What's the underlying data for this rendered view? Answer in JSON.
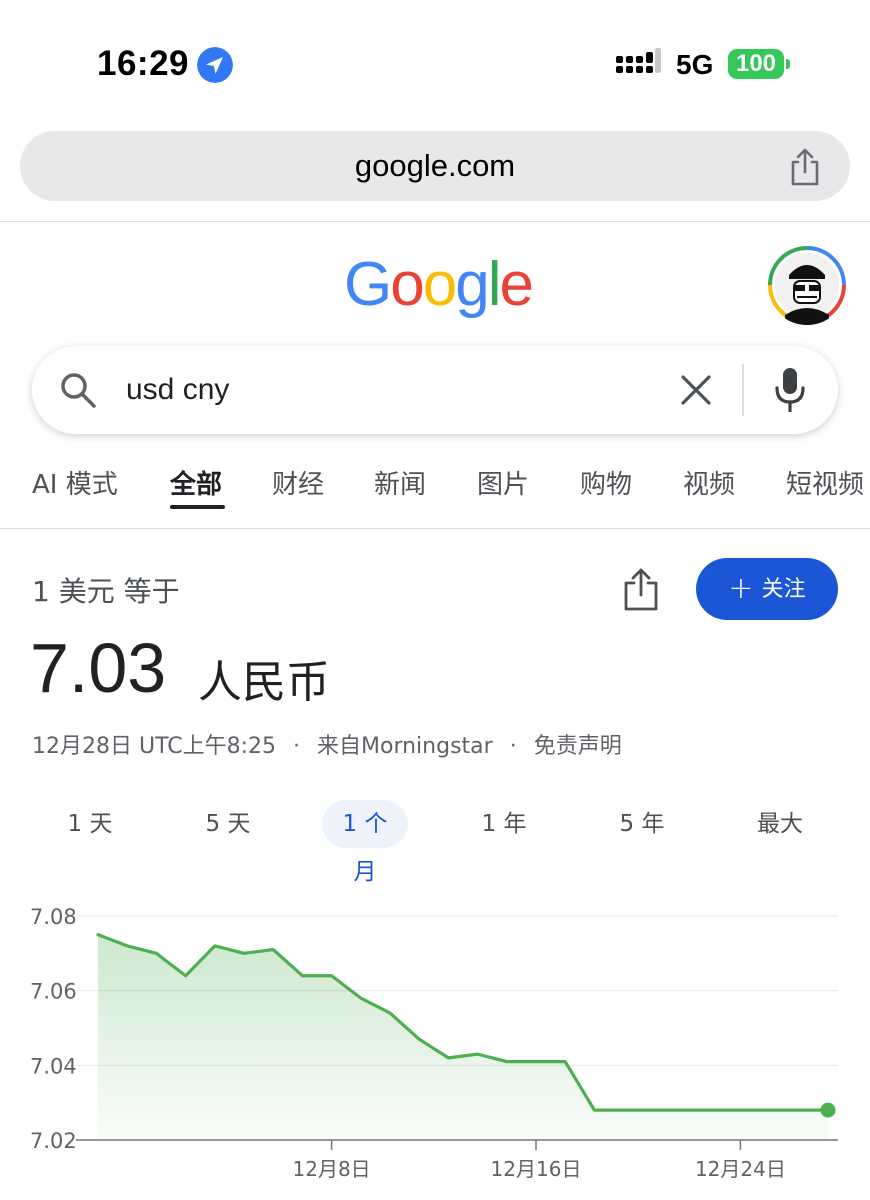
{
  "status_bar": {
    "time": "16:29",
    "location_icon": "location-arrow-icon",
    "signal_icon": "cellular-signal-icon",
    "network": "5G",
    "battery": "100",
    "battery_color": "#34c759"
  },
  "browser": {
    "url": "google.com",
    "share_icon": "share-icon"
  },
  "header": {
    "logo_letters": [
      "G",
      "o",
      "o",
      "g",
      "l",
      "e"
    ],
    "logo_colors": [
      "#4285F4",
      "#EA4335",
      "#FBBC05",
      "#4285F4",
      "#34A853",
      "#EA4335"
    ],
    "avatar_icon": "user-avatar-icon"
  },
  "search": {
    "query": "usd cny",
    "search_icon": "search-icon",
    "clear_icon": "clear-icon",
    "mic_icon": "microphone-icon"
  },
  "tabs": [
    {
      "label": "AI 模式"
    },
    {
      "label": "全部",
      "active": true
    },
    {
      "label": "财经"
    },
    {
      "label": "新闻"
    },
    {
      "label": "图片"
    },
    {
      "label": "购物"
    },
    {
      "label": "视频"
    },
    {
      "label": "短视频"
    }
  ],
  "currency": {
    "equals_text": "1 美元 等于",
    "rate": "7.03",
    "target_currency": "人民币",
    "follow_label": "关注",
    "follow_color": "#1a56d6",
    "meta": {
      "timestamp": "12月28日 UTC上午8:25",
      "separator": "·",
      "source": "来自Morningstar",
      "disclaimer": "免责声明"
    }
  },
  "range_tabs": [
    {
      "label": "1 天"
    },
    {
      "label": "5 天"
    },
    {
      "label": "1 个月",
      "active": true
    },
    {
      "label": "1 年"
    },
    {
      "label": "5 年"
    },
    {
      "label": "最大"
    }
  ],
  "chart_data": {
    "type": "area",
    "title": "",
    "xlabel": "",
    "ylabel": "",
    "line_color": "#4caf50",
    "ylim": [
      7.02,
      7.08
    ],
    "y_ticks": [
      "7.08",
      "7.06",
      "7.04",
      "7.02"
    ],
    "x_tick_labels": [
      "12月8日",
      "12月16日",
      "12月24日"
    ],
    "series": [
      {
        "x": [
          "11月28日",
          "11月29日",
          "12月1日",
          "12月2日",
          "12月3日",
          "12月4日",
          "12月5日",
          "12月6日",
          "12月8日",
          "12月9日",
          "12月10日",
          "12月11日",
          "12月12日",
          "12月13日",
          "12月15日",
          "12月16日",
          "12月17日",
          "12月18日",
          "12月19日",
          "12月20日",
          "12月22日",
          "12月23日",
          "12月24日",
          "12月25日",
          "12月26日",
          "12月28日"
        ],
        "values": [
          7.075,
          7.072,
          7.07,
          7.064,
          7.072,
          7.07,
          7.071,
          7.064,
          7.064,
          7.058,
          7.054,
          7.047,
          7.042,
          7.043,
          7.041,
          7.041,
          7.041,
          7.028,
          7.028,
          7.028,
          7.028,
          7.028,
          7.028,
          7.028,
          7.028,
          7.028
        ]
      }
    ]
  }
}
